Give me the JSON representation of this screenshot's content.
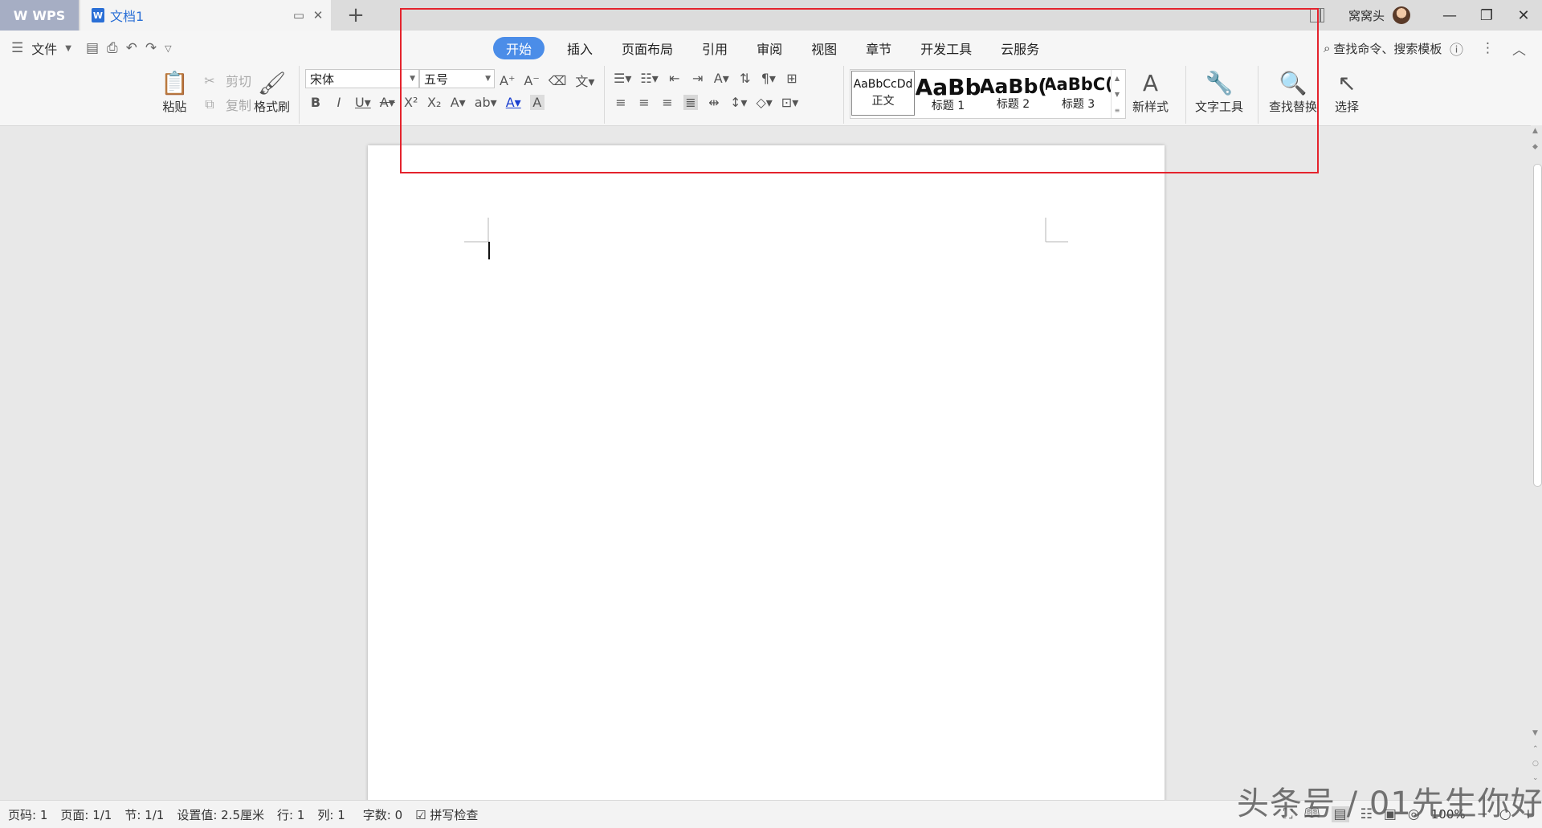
{
  "titlebar": {
    "app_label": "WPS",
    "doc_title": "文档1",
    "new_tab": "+",
    "user_name": "窝窝头"
  },
  "quick_access": {
    "menu_label": "文件"
  },
  "tabs": [
    "开始",
    "插入",
    "页面布局",
    "引用",
    "审阅",
    "视图",
    "章节",
    "开发工具",
    "云服务"
  ],
  "search_command": "查找命令、搜索模板",
  "clipboard": {
    "paste": "粘贴",
    "cut": "剪切",
    "copy": "复制",
    "format_painter": "格式刷"
  },
  "font": {
    "family": "宋体",
    "size": "五号"
  },
  "styles": [
    {
      "sample": "AaBbCcDd",
      "name": "正文"
    },
    {
      "sample": "AaBb",
      "name": "标题 1"
    },
    {
      "sample": "AaBb(",
      "name": "标题 2"
    },
    {
      "sample": "AaBbC(",
      "name": "标题 3"
    }
  ],
  "tools": {
    "new_style": "新样式",
    "text_tools": "文字工具",
    "find_replace": "查找替换",
    "select": "选择"
  },
  "status": {
    "page_no": "页码: 1",
    "pages": "页面: 1/1",
    "section": "节: 1/1",
    "setting": "设置值: 2.5厘米",
    "row": "行: 1",
    "col": "列: 1",
    "word_count": "字数: 0",
    "spell_check": "拼写检查",
    "zoom": "100%"
  },
  "watermark": "头条号 / 01先生你好",
  "colors": {
    "accent": "#4b8de8",
    "highlight_box": "#e4232d",
    "wps_tab": "#a6aec4"
  }
}
